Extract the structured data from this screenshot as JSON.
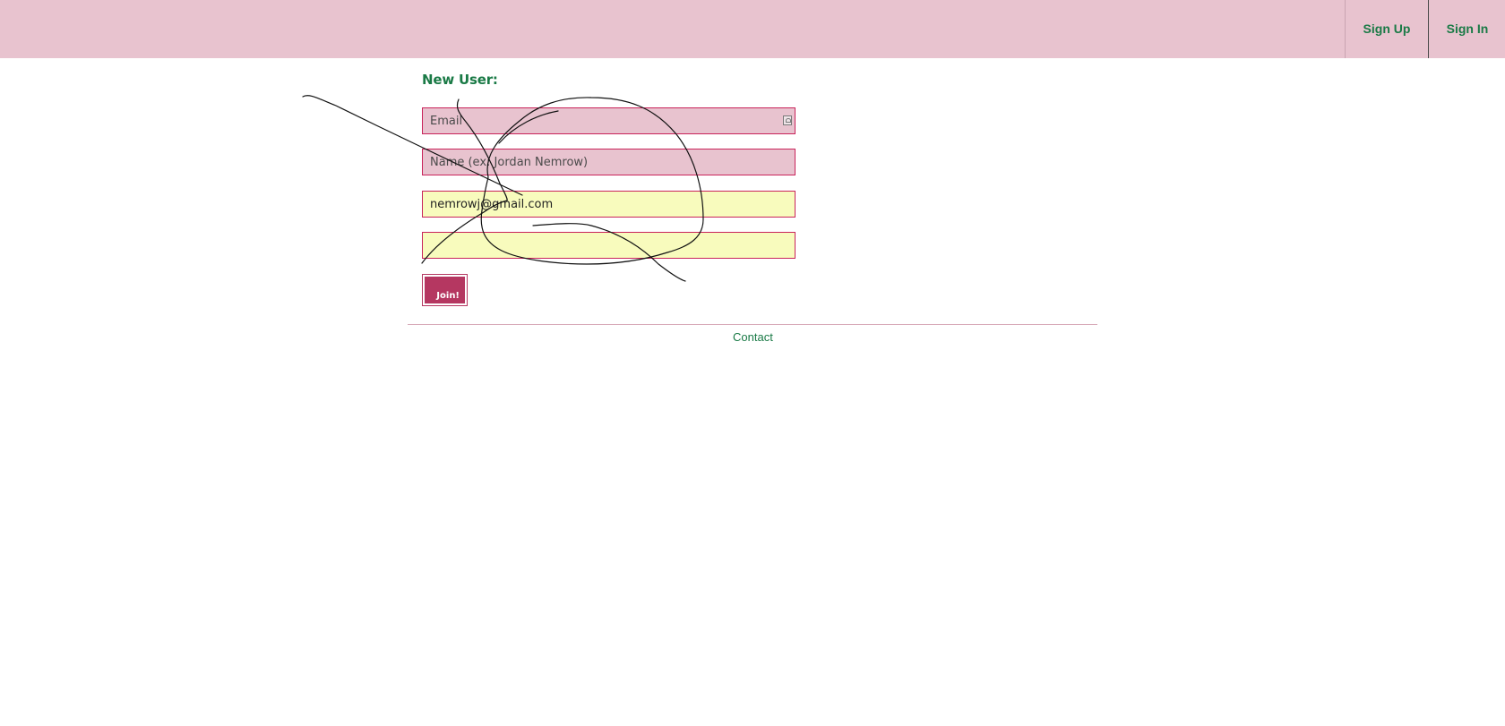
{
  "header": {
    "sign_up_label": "Sign Up",
    "sign_in_label": "Sign In"
  },
  "form": {
    "heading": "New User:",
    "email_placeholder": "Email",
    "name_placeholder": "Name (ex: Jordan Nemrow)",
    "email_confirm_value": "nemrowj@gmail.com",
    "password_value": "",
    "join_label": "Join!"
  },
  "footer": {
    "contact_label": "Contact"
  },
  "colors": {
    "header_bg": "#e8c3cf",
    "accent_green": "#1a7a46",
    "field_border": "#c9235a",
    "autofill_yellow": "#f8fbbd",
    "button_bg": "#b53761"
  },
  "icons": {
    "email_field_icon": "contact-card-icon"
  }
}
